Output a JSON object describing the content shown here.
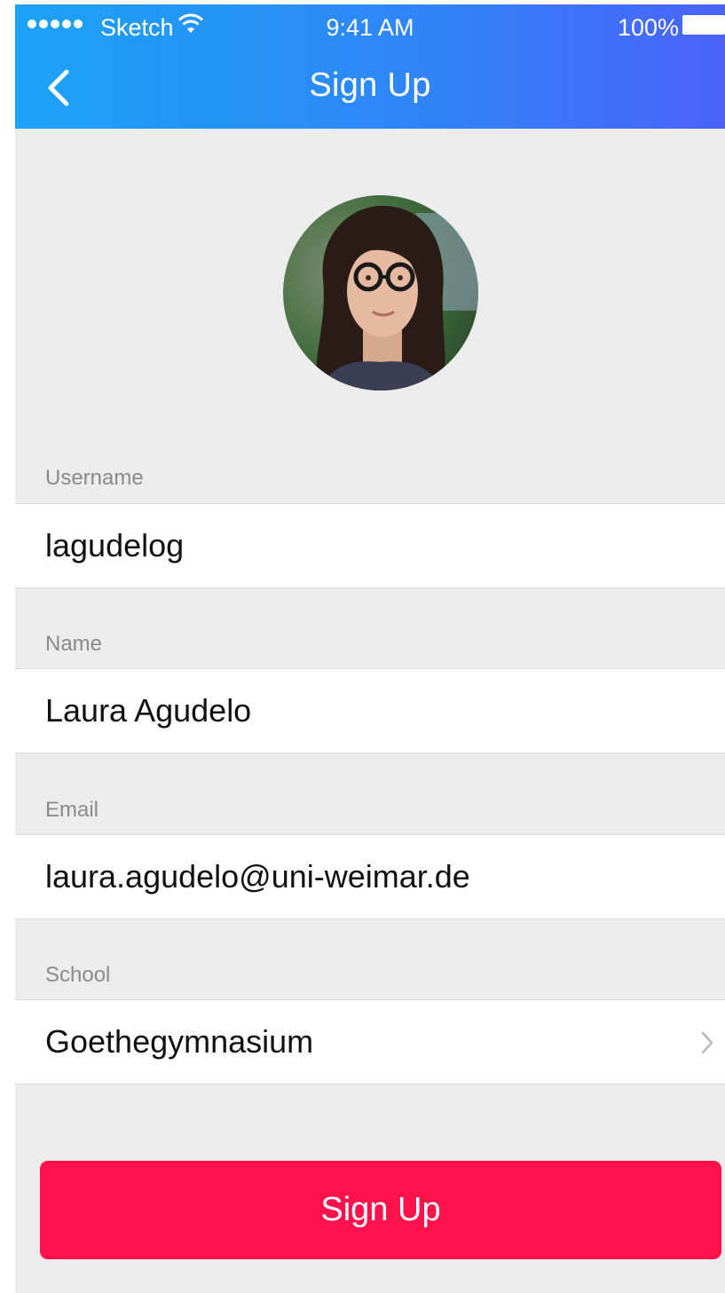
{
  "status_bar": {
    "carrier": "Sketch",
    "time": "9:41 AM",
    "battery": "100%"
  },
  "nav": {
    "title": "Sign Up",
    "back_icon": "chevron-left-icon"
  },
  "avatar": {
    "icon": "user-avatar-photo"
  },
  "form": {
    "fields": [
      {
        "label": "Username",
        "value": "lagudelog"
      },
      {
        "label": "Name",
        "value": "Laura Agudelo"
      },
      {
        "label": "Email",
        "value": "laura.agudelo@uni-weimar.de"
      },
      {
        "label": "School",
        "value": "Goethegymnasium"
      }
    ]
  },
  "submit": {
    "label": "Sign Up"
  },
  "colors": {
    "header_gradient_start": "#1ba3f4",
    "header_gradient_end": "#4a63f9",
    "button": "#ff1149",
    "background": "#ececec"
  }
}
